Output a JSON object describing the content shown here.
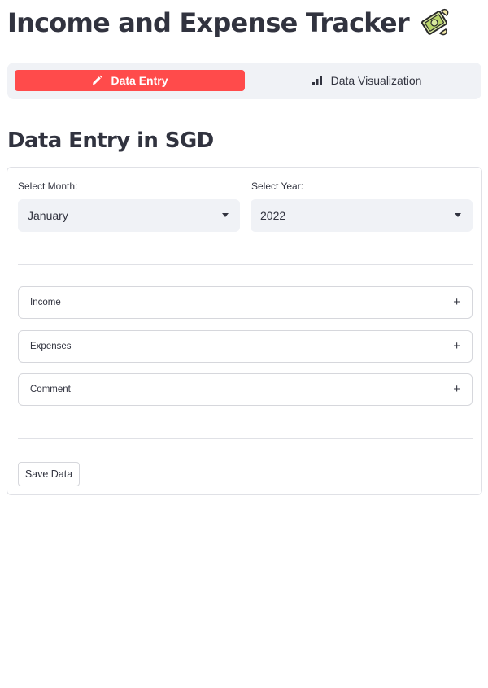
{
  "header": {
    "title": "Income and Expense Tracker",
    "emoji_icon": "money-with-wings-icon"
  },
  "tabs": [
    {
      "label": "Data Entry",
      "icon": "pencil-icon",
      "active": true
    },
    {
      "label": "Data Visualization",
      "icon": "bar-chart-icon",
      "active": false
    }
  ],
  "section": {
    "heading": "Data Entry in SGD"
  },
  "form": {
    "month": {
      "label": "Select Month:",
      "value": "January"
    },
    "year": {
      "label": "Select Year:",
      "value": "2022"
    },
    "expanders": [
      {
        "label": "Income"
      },
      {
        "label": "Expenses"
      },
      {
        "label": "Comment"
      }
    ],
    "save_label": "Save Data"
  },
  "colors": {
    "accent": "#ff4b4b",
    "text": "#31333f",
    "surface": "#f0f2f6",
    "border": "#e0e1e6"
  }
}
